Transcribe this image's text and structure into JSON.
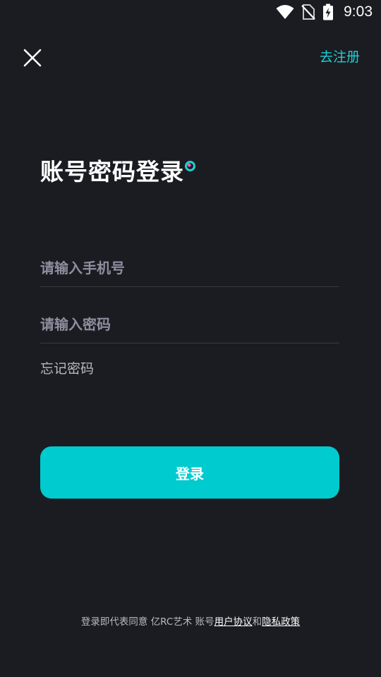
{
  "status_bar": {
    "time": "9:03",
    "icons": [
      "wifi-icon",
      "no-sim-icon",
      "battery-charging-icon"
    ]
  },
  "nav": {
    "close_icon": "close-icon",
    "register_label": "去注册"
  },
  "title": {
    "text": "账号密码登录"
  },
  "form": {
    "phone_placeholder": "请输入手机号",
    "phone_value": "",
    "password_placeholder": "请输入密码",
    "password_value": "",
    "forgot_label": "忘记密码",
    "login_label": "登录"
  },
  "agreement": {
    "prefix": "登录即代表同意 亿RC艺术 账号",
    "user_agreement": "用户协议",
    "conjunction": "和",
    "privacy_policy": "隐私政策"
  },
  "colors": {
    "background": "#1b1c21",
    "accent": "#00cbcf",
    "link": "#1fd0d3",
    "placeholder": "#8d8e9e",
    "divider": "#3a3b41"
  }
}
